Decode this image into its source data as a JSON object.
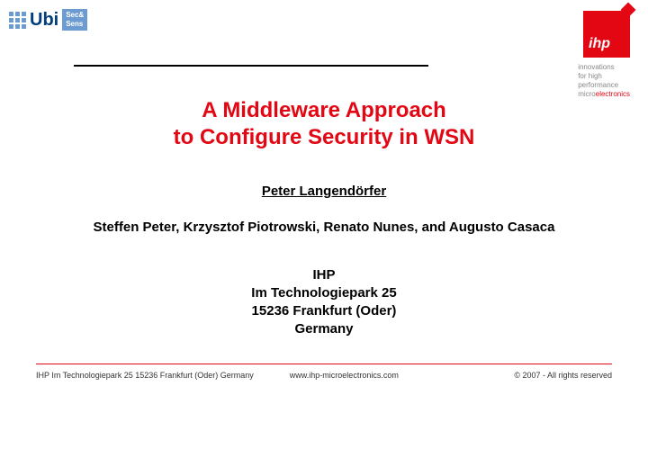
{
  "ubi": {
    "text": "Ubi",
    "r1": "Sec&",
    "r2": "Sens"
  },
  "ihp": {
    "logo": "ihp",
    "tag1": "innovations",
    "tag2": "for high",
    "tag3": "performance",
    "tag4a": "micro",
    "tag4b": "electronics"
  },
  "title": {
    "l1": "A Middleware Approach",
    "l2": "to Configure Security in WSN"
  },
  "author_main": "Peter Langendörfer",
  "authors": "Steffen Peter, Krzysztof Piotrowski, Renato Nunes, and Augusto Casaca",
  "affil": {
    "l1": "IHP",
    "l2": "Im Technologiepark 25",
    "l3": "15236 Frankfurt (Oder)",
    "l4": "Germany"
  },
  "footer": {
    "left": "IHP   Im Technologiepark 25   15236 Frankfurt (Oder) Germany",
    "mid": "www.ihp-microelectronics.com",
    "right": "© 2007 - All rights reserved"
  }
}
